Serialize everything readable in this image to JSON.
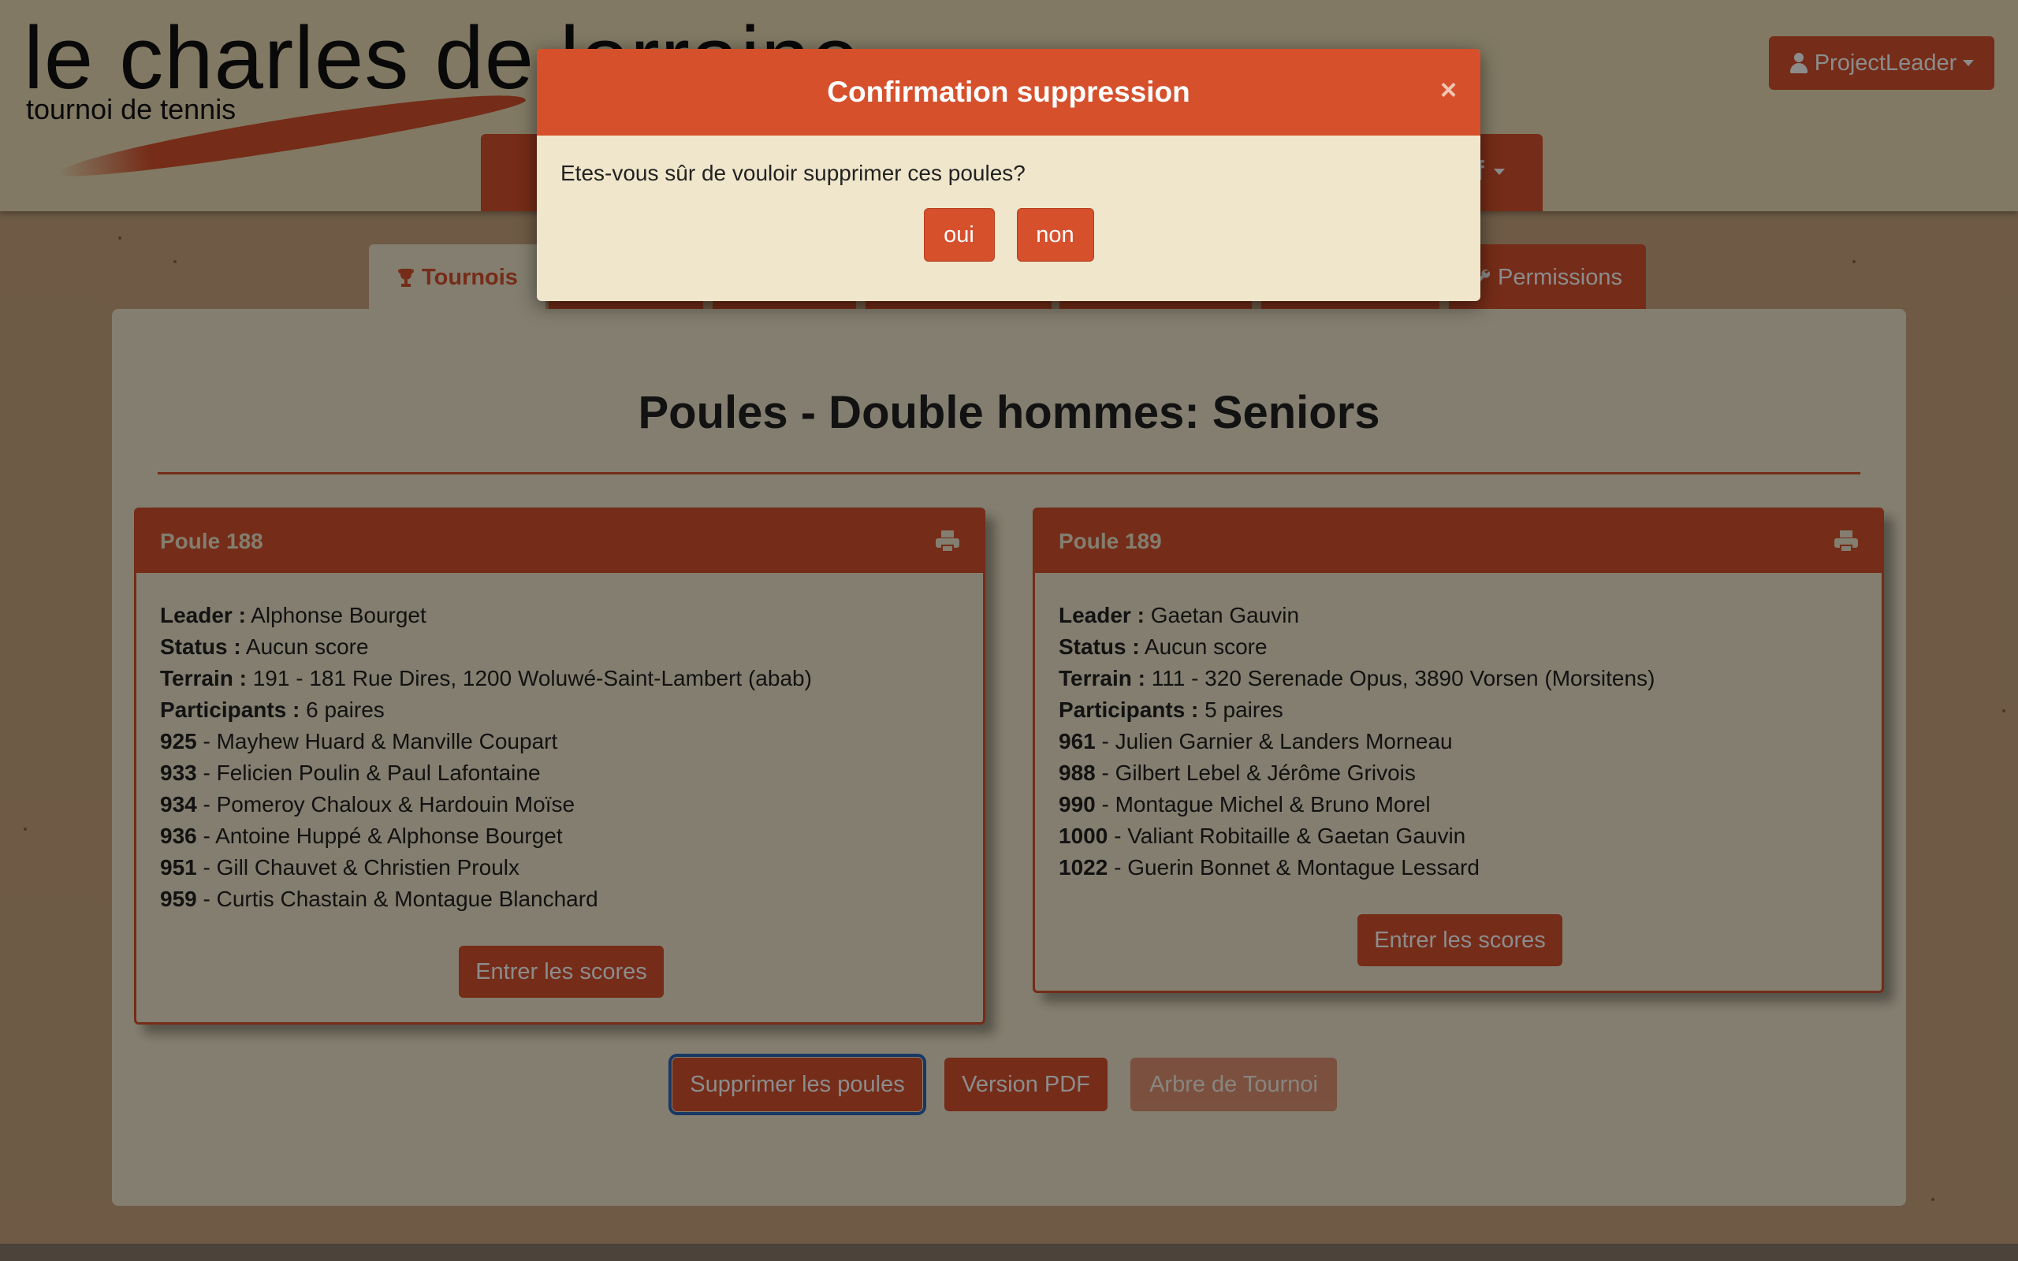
{
  "header": {
    "logo_title": "le charles de lorraine",
    "logo_subtitle": "tournoi de tennis",
    "user_menu_label": "ProjectLeader",
    "nav_partial_label": "ff"
  },
  "tabs": {
    "tournois": "Tournois",
    "permissions": "Permissions"
  },
  "page": {
    "title": "Poules - Double hommes: Seniors"
  },
  "poules": [
    {
      "name": "Poule 188",
      "leader_label": "Leader :",
      "leader": "Alphonse Bourget",
      "status_label": "Status :",
      "status": "Aucun score",
      "terrain_label": "Terrain :",
      "terrain": "191 - 181 Rue Dires, 1200 Woluwé-Saint-Lambert (abab)",
      "participants_label": "Participants :",
      "participants": "6 paires",
      "pairs": [
        {
          "id": "925",
          "names": "Mayhew Huard & Manville Coupart"
        },
        {
          "id": "933",
          "names": "Felicien Poulin & Paul Lafontaine"
        },
        {
          "id": "934",
          "names": "Pomeroy Chaloux & Hardouin Moïse"
        },
        {
          "id": "936",
          "names": "Antoine Huppé & Alphonse Bourget"
        },
        {
          "id": "951",
          "names": "Gill Chauvet & Christien Proulx"
        },
        {
          "id": "959",
          "names": "Curtis Chastain & Montague Blanchard"
        }
      ],
      "scores_button": "Entrer les scores"
    },
    {
      "name": "Poule 189",
      "leader_label": "Leader :",
      "leader": "Gaetan Gauvin",
      "status_label": "Status :",
      "status": "Aucun score",
      "terrain_label": "Terrain :",
      "terrain": "111 - 320 Serenade Opus, 3890 Vorsen (Morsitens)",
      "participants_label": "Participants :",
      "participants": "5 paires",
      "pairs": [
        {
          "id": "961",
          "names": "Julien Garnier & Landers Morneau"
        },
        {
          "id": "988",
          "names": "Gilbert Lebel & Jérôme Grivois"
        },
        {
          "id": "990",
          "names": "Montague Michel & Bruno Morel"
        },
        {
          "id": "1000",
          "names": "Valiant Robitaille & Gaetan Gauvin"
        },
        {
          "id": "1022",
          "names": "Guerin Bonnet & Montague Lessard"
        }
      ],
      "scores_button": "Entrer les scores"
    }
  ],
  "actions": {
    "delete": "Supprimer les poules",
    "pdf": "Version PDF",
    "tree": "Arbre de Tournoi"
  },
  "modal": {
    "title": "Confirmation suppression",
    "close": "×",
    "message": "Etes-vous sûr de vouloir supprimer ces poules?",
    "yes": "oui",
    "no": "non"
  },
  "colors": {
    "accent": "#d6502c",
    "panel": "#efe6cb",
    "page_bg": "#c9a57e"
  }
}
